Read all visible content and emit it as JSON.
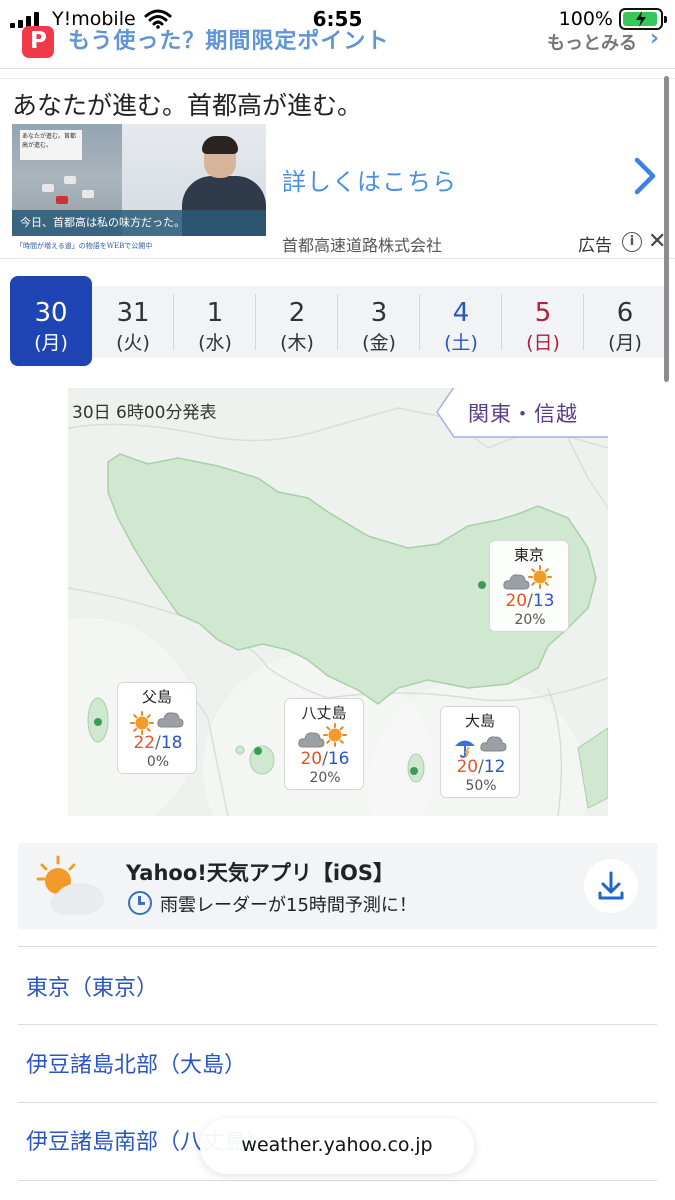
{
  "status_bar": {
    "carrier": "Y!mobile",
    "time": "6:55",
    "battery": "100%"
  },
  "points_banner": {
    "label": "もう使った？期間限定ポイント",
    "more": "もっとみる",
    "logo_letter": "P"
  },
  "ad": {
    "headline": "あなたが進む。首都高が進む。",
    "image_sign": "あなたが進む。首都高が進む。",
    "image_caption": "今日、首都高は私の味方だった。",
    "image_footer": "「時間が増える道」の物語をWEBで公開中",
    "cta": "詳しくはこちら",
    "company": "首都高速道路株式会社",
    "label": "広告"
  },
  "date_tabs": [
    {
      "day": "30",
      "weekday": "(月)",
      "kind": "active"
    },
    {
      "day": "31",
      "weekday": "(火)",
      "kind": "normal"
    },
    {
      "day": "1",
      "weekday": "(水)",
      "kind": "normal"
    },
    {
      "day": "2",
      "weekday": "(木)",
      "kind": "normal"
    },
    {
      "day": "3",
      "weekday": "(金)",
      "kind": "normal"
    },
    {
      "day": "4",
      "weekday": "(土)",
      "kind": "sat"
    },
    {
      "day": "5",
      "weekday": "(日)",
      "kind": "sun"
    },
    {
      "day": "6",
      "weekday": "(月)",
      "kind": "normal"
    }
  ],
  "map": {
    "issued": "30日 6時00分発表",
    "region": "関東・信越",
    "locations": [
      {
        "name": "東京",
        "icons": [
          "cloud-icon",
          "sun-icon"
        ],
        "high": "20",
        "low": "13",
        "pop": "20%"
      },
      {
        "name": "父島",
        "icons": [
          "sun-icon",
          "cloud-icon"
        ],
        "high": "22",
        "low": "18",
        "pop": "0%"
      },
      {
        "name": "八丈島",
        "icons": [
          "cloud-icon",
          "sun-icon"
        ],
        "high": "20",
        "low": "16",
        "pop": "20%"
      },
      {
        "name": "大島",
        "icons": [
          "umbrella-icon",
          "cloud-icon"
        ],
        "high": "20",
        "low": "12",
        "pop": "50%"
      }
    ]
  },
  "app_promo": {
    "title": "Yahoo!天気アプリ【iOS】",
    "subtitle": "雨雲レーダーが15時間予測に！"
  },
  "links": [
    "東京（東京）",
    "伊豆諸島北部（大島）",
    "伊豆諸島南部（八丈島）"
  ],
  "url_bar": {
    "domain": "weather.yahoo.co.jp"
  },
  "colors": {
    "active_tab": "#1f45b5",
    "link": "#2a56c4",
    "high_temp": "#e0562a",
    "low_temp": "#2a56c4",
    "saturday": "#2a56c4",
    "sunday": "#b0203a",
    "map_land": "#cfe8cf"
  }
}
